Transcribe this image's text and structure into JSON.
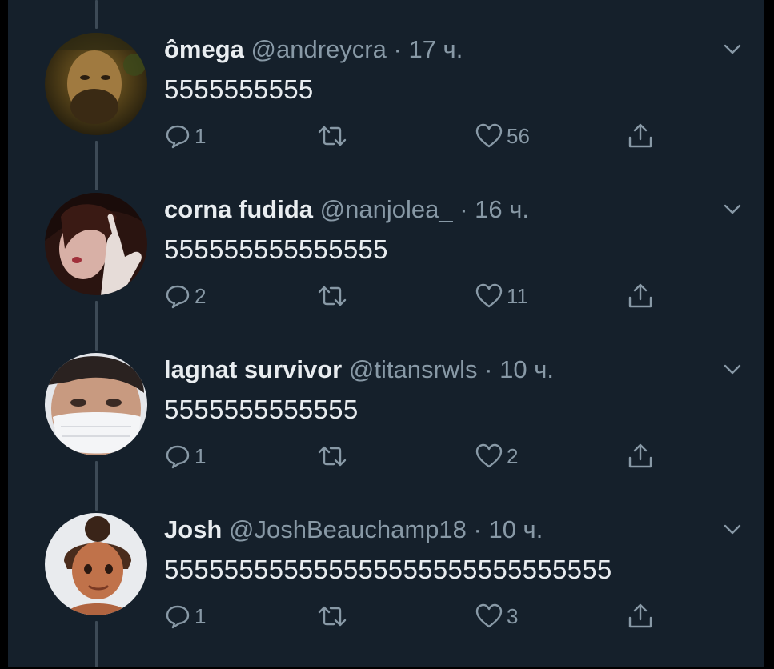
{
  "tweets": [
    {
      "name": "ômega",
      "handle": "@andreycra",
      "separator": "·",
      "time": "17 ч.",
      "text": "5555555555",
      "replies": "1",
      "retweets": "",
      "likes": "56"
    },
    {
      "name": "corna fudida",
      "handle": "@nanjolea_",
      "separator": "·",
      "time": "16 ч.",
      "text": "555555555555555",
      "replies": "2",
      "retweets": "",
      "likes": "11"
    },
    {
      "name": "lagnat survivor",
      "handle": "@titansrwls",
      "separator": "·",
      "time": "10 ч.",
      "text": "5555555555555",
      "replies": "1",
      "retweets": "",
      "likes": "2"
    },
    {
      "name": "Josh",
      "handle": "@JoshBeauchamp18",
      "separator": "·",
      "time": "10 ч.",
      "text": "555555555555555555555555555555",
      "replies": "1",
      "retweets": "",
      "likes": "3"
    }
  ],
  "icons": {
    "reply": "reply-icon",
    "retweet": "retweet-icon",
    "like": "heart-icon",
    "share": "share-icon",
    "menu": "chevron-down-icon"
  },
  "colors": {
    "background": "#15202b",
    "text": "#e8ecef",
    "secondary": "#8899a6",
    "thread_line": "#3d4a56"
  }
}
